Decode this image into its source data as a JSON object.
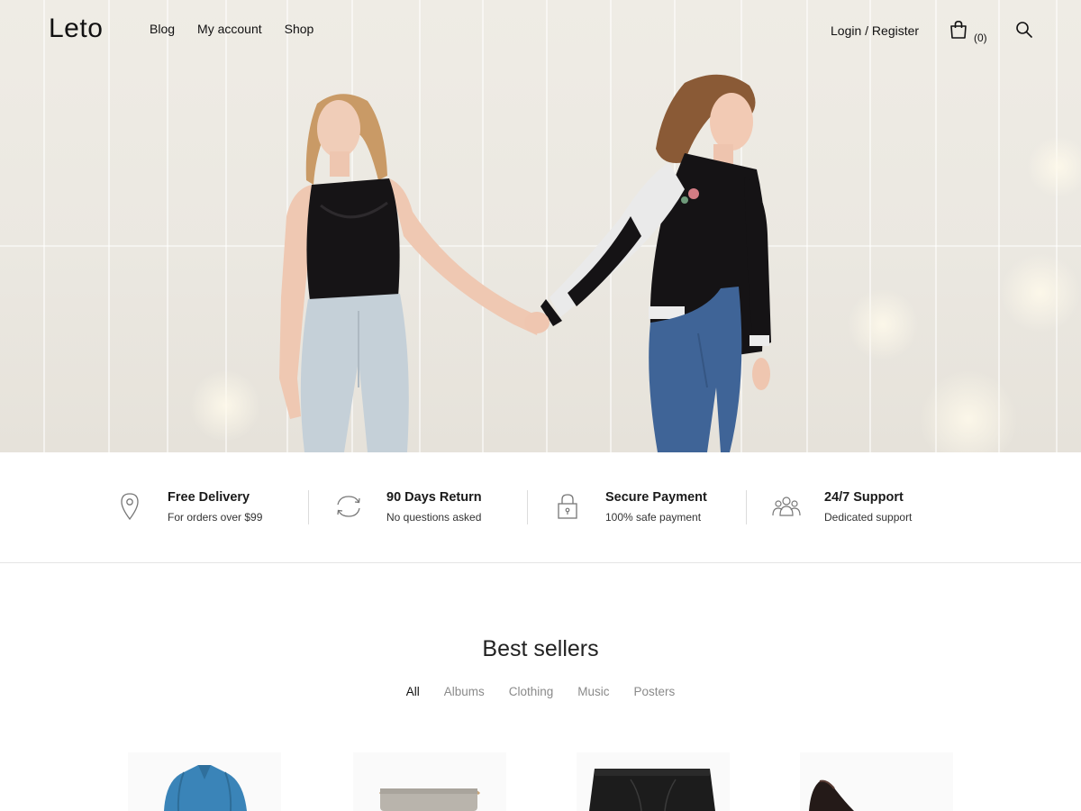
{
  "header": {
    "logo": "Leto",
    "nav": [
      "Blog",
      "My account",
      "Shop"
    ],
    "login": "Login / Register",
    "cart_count": "(0)"
  },
  "features": [
    {
      "title": "Free Delivery",
      "subtitle": "For orders over $99",
      "icon": "location-pin-icon"
    },
    {
      "title": "90 Days Return",
      "subtitle": "No questions asked",
      "icon": "refresh-icon"
    },
    {
      "title": "Secure Payment",
      "subtitle": "100% safe payment",
      "icon": "lock-icon"
    },
    {
      "title": "24/7 Support",
      "subtitle": "Dedicated support",
      "icon": "people-icon"
    }
  ],
  "best_sellers": {
    "title": "Best sellers",
    "filters": [
      "All",
      "Albums",
      "Clothing",
      "Music",
      "Posters"
    ],
    "active_filter": "All"
  },
  "products": [
    {
      "image": "blue-fur-jacket"
    },
    {
      "image": "grey-handbag"
    },
    {
      "image": "black-leather-skirt"
    },
    {
      "image": "black-heel-shoe"
    }
  ],
  "colors": {
    "text": "#111111",
    "muted": "#8a8a8a",
    "hero_wall": "#ebe8e1",
    "divider": "#dcdcdc"
  }
}
